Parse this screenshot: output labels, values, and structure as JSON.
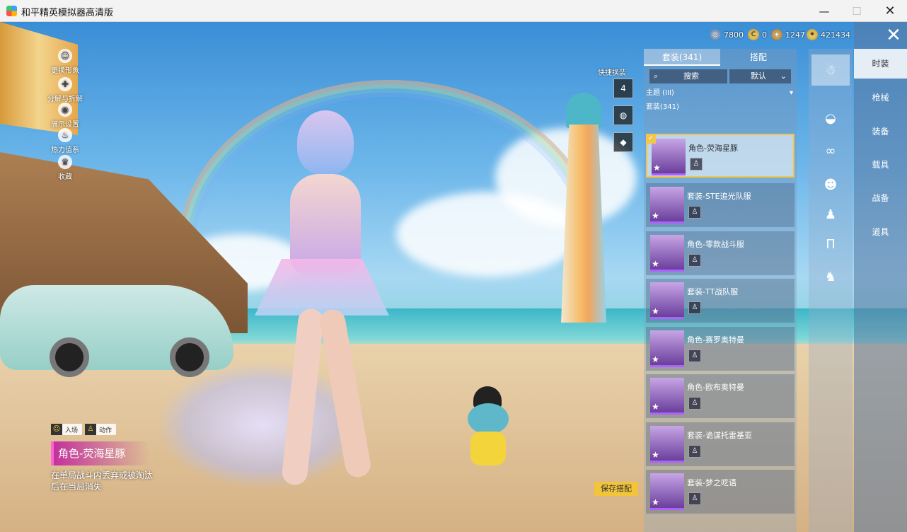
{
  "window": {
    "title": "和平精英模拟器高清版",
    "controls": {
      "minimize": "—",
      "maximize": "☐",
      "close": "✕"
    }
  },
  "left_menu": [
    {
      "label": "更换形象",
      "icon": "person-icon",
      "glyph": "☺"
    },
    {
      "label": "分解与拆解",
      "icon": "dismantle-icon",
      "glyph": "✚"
    },
    {
      "label": "展示设置",
      "icon": "eye-icon",
      "glyph": "◉"
    },
    {
      "label": "热力值系",
      "icon": "flame-icon",
      "glyph": "♨"
    },
    {
      "label": "收藏",
      "icon": "crown-icon",
      "glyph": "♛"
    }
  ],
  "character_info": {
    "entry_label": "入场",
    "action_label": "动作",
    "name": "角色-荧海星豚",
    "description": "在单局战斗内丢弃或被淘汰后在当局消失"
  },
  "currencies": [
    {
      "icon": "silver-coin-icon",
      "value": "7800",
      "glyph": "◎"
    },
    {
      "icon": "gold-coin-icon",
      "value": "0",
      "glyph": "C"
    },
    {
      "icon": "medal-coin-icon",
      "value": "1247",
      "glyph": "◈"
    },
    {
      "icon": "points-coin-icon",
      "value": "421434",
      "glyph": "✦"
    }
  ],
  "quick_swap": {
    "label": "快捷换装",
    "buttons": [
      {
        "icon": "hanger-icon",
        "glyph": "4"
      },
      {
        "icon": "emblem-icon",
        "glyph": "◍"
      },
      {
        "icon": "diamond-icon",
        "glyph": "◆"
      }
    ]
  },
  "panel": {
    "tabs": [
      {
        "label": "套装(341)",
        "active": true
      },
      {
        "label": "搭配",
        "active": false
      }
    ],
    "search_label": "搜索",
    "sort_label": "默认",
    "theme_label": "主题 (III)",
    "section_label": "套装(341)",
    "items": [
      {
        "name": "角色-荧海星豚",
        "selected": true
      },
      {
        "name": "套装-STE追光队服",
        "selected": false
      },
      {
        "name": "角色-零款战斗服",
        "selected": false
      },
      {
        "name": "套装-TT战队服",
        "selected": false
      },
      {
        "name": "角色-赛罗奥特曼",
        "selected": false
      },
      {
        "name": "角色-欧布奥特曼",
        "selected": false
      },
      {
        "name": "套装-诡谋托雷基亚",
        "selected": false
      },
      {
        "name": "套装-梦之呓语",
        "selected": false
      }
    ],
    "save_label": "保存搭配"
  },
  "icon_column": [
    {
      "icon": "full-body-icon",
      "glyph": "☃",
      "active": true
    },
    {
      "icon": "cap-icon",
      "glyph": "◒",
      "active": false
    },
    {
      "icon": "glasses-icon",
      "glyph": "∞",
      "active": false
    },
    {
      "icon": "mask-icon",
      "glyph": "☻",
      "active": false
    },
    {
      "icon": "top-icon",
      "glyph": "♟",
      "active": false
    },
    {
      "icon": "pants-icon",
      "glyph": "Π",
      "active": false
    },
    {
      "icon": "shoes-icon",
      "glyph": "♞",
      "active": false
    }
  ],
  "categories": [
    {
      "label": "时装",
      "active": true
    },
    {
      "label": "枪械",
      "active": false
    },
    {
      "label": "装备",
      "active": false
    },
    {
      "label": "载具",
      "active": false
    },
    {
      "label": "战备",
      "active": false
    },
    {
      "label": "道具",
      "active": false
    }
  ],
  "close_glyph": "✕",
  "colors": {
    "accent": "#f2c43a",
    "highlight": "#c3329c",
    "panel": "#7896b9"
  }
}
